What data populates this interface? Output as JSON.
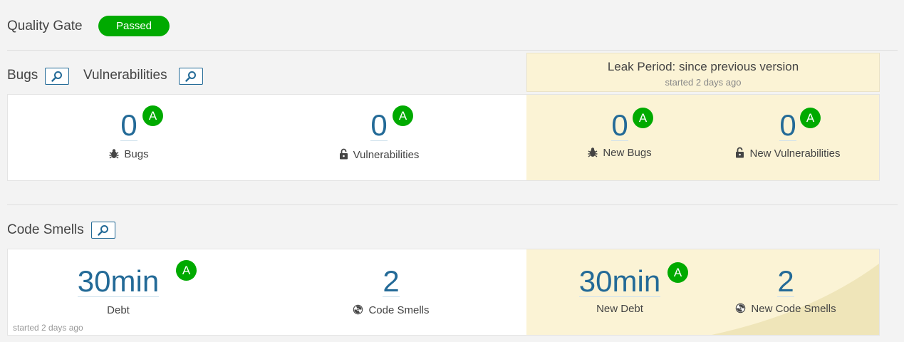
{
  "quality_gate": {
    "title": "Quality Gate",
    "status": "Passed",
    "status_color": "#00aa00"
  },
  "reliability_section": {
    "bugs_title": "Bugs",
    "vulnerabilities_title": "Vulnerabilities"
  },
  "leak_period": {
    "title": "Leak Period: since previous version",
    "subtitle": "started 2 days ago"
  },
  "overall": {
    "bugs": {
      "value": "0",
      "label": "Bugs",
      "rating": "A",
      "icon": "bug-icon"
    },
    "vulnerabilities": {
      "value": "0",
      "label": "Vulnerabilities",
      "rating": "A",
      "icon": "lock-icon"
    }
  },
  "leak": {
    "new_bugs": {
      "value": "0",
      "label": "New Bugs",
      "rating": "A",
      "icon": "bug-icon"
    },
    "new_vulnerabilities": {
      "value": "0",
      "label": "New Vulnerabilities",
      "rating": "A",
      "icon": "lock-icon"
    }
  },
  "code_smells_section": {
    "title": "Code Smells"
  },
  "maintainability": {
    "debt": {
      "value": "30min",
      "label": "Debt",
      "rating": "A"
    },
    "code_smells": {
      "value": "2",
      "label": "Code Smells",
      "icon": "radiation-icon"
    },
    "started_note": "started 2 days ago"
  },
  "maintainability_leak": {
    "new_debt": {
      "value": "30min",
      "label": "New Debt",
      "rating": "A"
    },
    "new_code_smells": {
      "value": "2",
      "label": "New Code Smells",
      "icon": "radiation-icon"
    }
  },
  "colors": {
    "accent": "#236a97",
    "leak_background": "#fbf3d5",
    "rating_a": "#00aa00"
  }
}
